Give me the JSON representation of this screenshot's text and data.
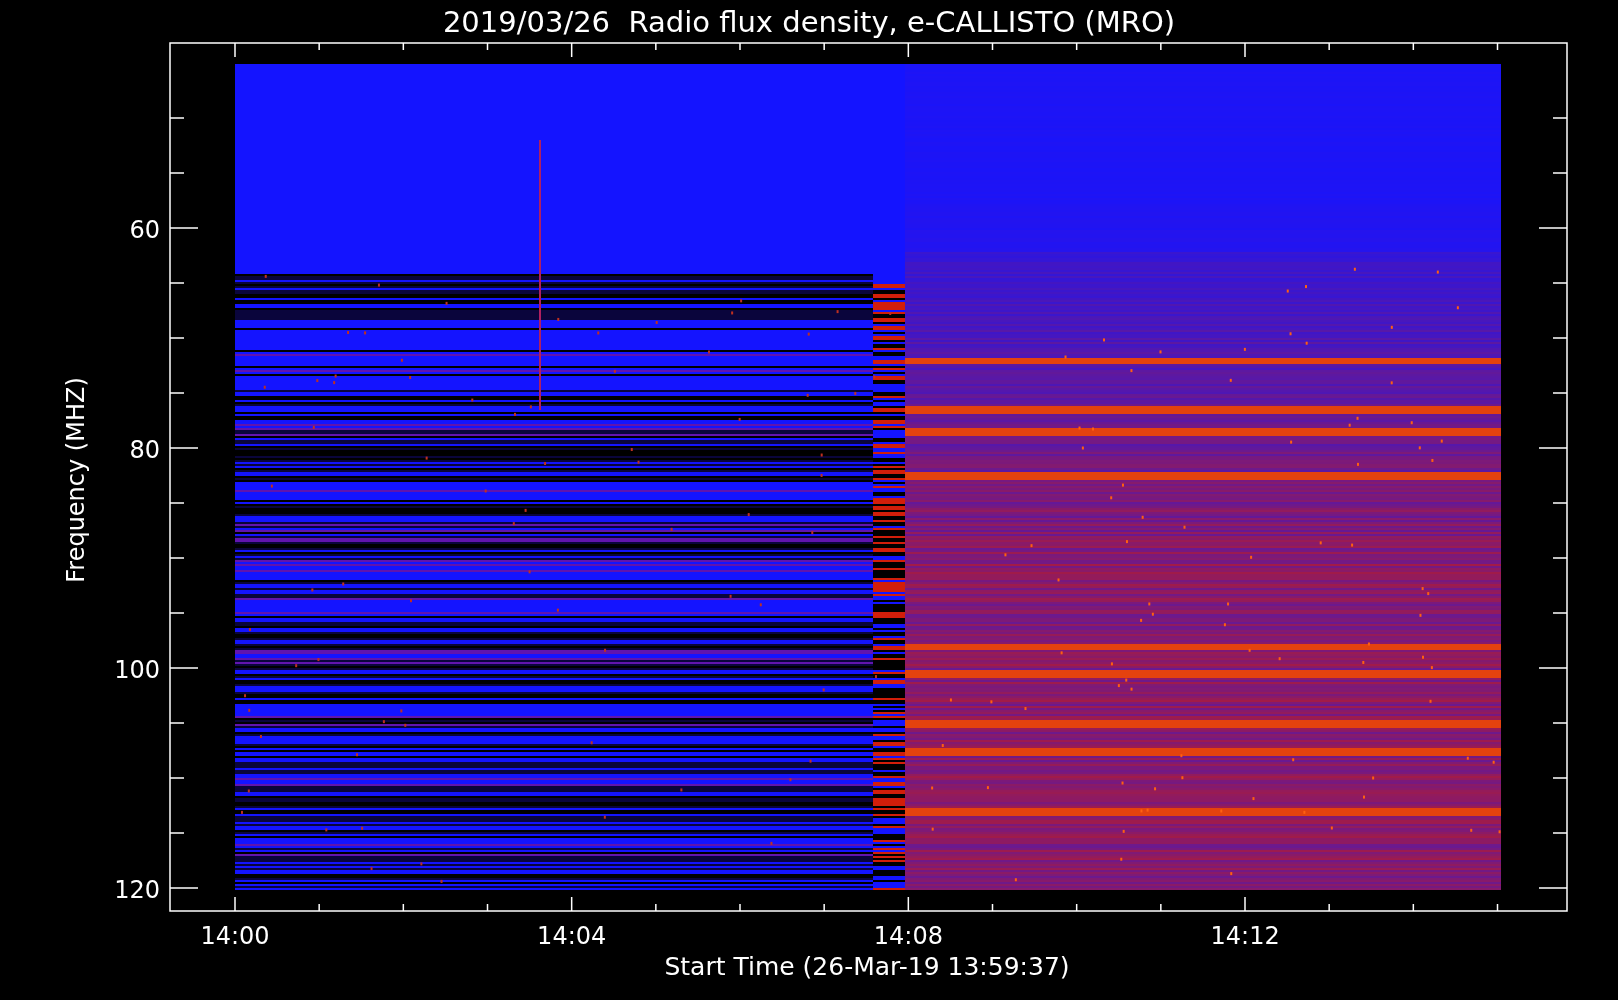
{
  "plot": {
    "title": "2019/03/26  Radio flux density, e-CALLISTO (MRO)",
    "ylabel": "Frequency (MHZ)",
    "xlabel": "Start Time (26-Mar-19 13:59:37)",
    "yticks": [
      "60",
      "80",
      "100",
      "120"
    ],
    "xticks": [
      "14:00",
      "14:04",
      "14:08",
      "14:12"
    ]
  }
}
